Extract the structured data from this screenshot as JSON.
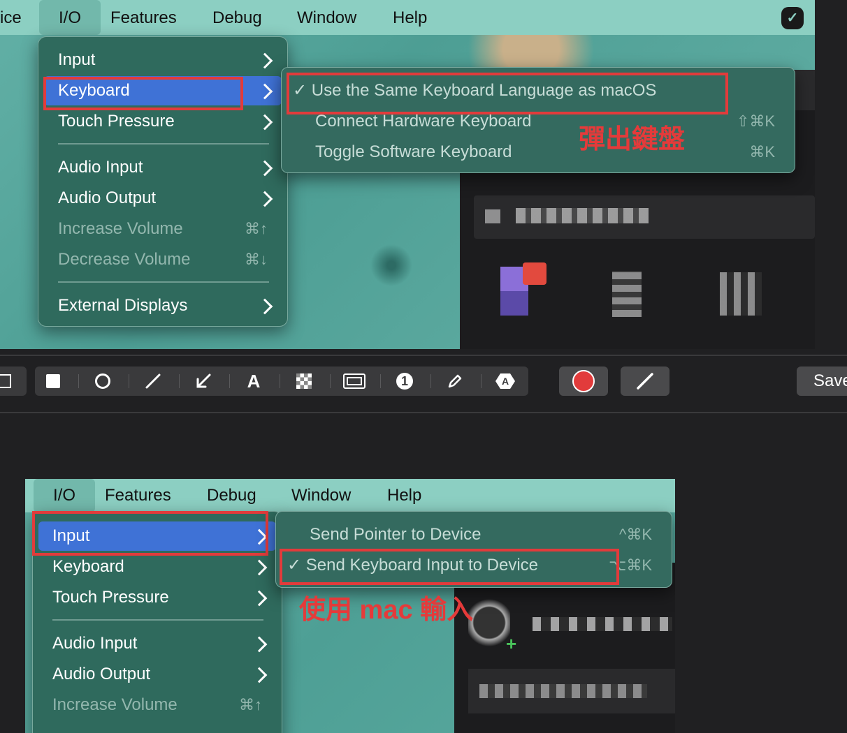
{
  "top": {
    "menubar": {
      "partial_label": "ice",
      "io": "I/O",
      "features": "Features",
      "debug": "Debug",
      "window": "Window",
      "help": "Help"
    },
    "io_menu": {
      "items": [
        {
          "label": "Input",
          "submenu": true
        },
        {
          "label": "Keyboard",
          "submenu": true,
          "highlighted": true
        },
        {
          "label": "Touch Pressure",
          "submenu": true
        },
        {
          "label": "Audio Input",
          "submenu": true
        },
        {
          "label": "Audio Output",
          "submenu": true
        },
        {
          "label": "Increase Volume",
          "shortcut": "⌘↑",
          "disabled": true
        },
        {
          "label": "Decrease Volume",
          "shortcut": "⌘↓",
          "disabled": true
        },
        {
          "label": "External Displays",
          "submenu": true
        }
      ]
    },
    "keyboard_submenu": {
      "items": [
        {
          "label": "✓ Use the Same Keyboard Language as macOS",
          "shortcut": ""
        },
        {
          "label": "Connect Hardware Keyboard",
          "shortcut": "⇧⌘K"
        },
        {
          "label": "Toggle Software Keyboard",
          "shortcut": "⌘K"
        }
      ]
    },
    "annotation": "彈出鍵盤"
  },
  "toolbar": {
    "tools": [
      {
        "icon": "filled-square-icon"
      },
      {
        "icon": "circle-icon"
      },
      {
        "icon": "line-icon"
      },
      {
        "icon": "arrow-icon"
      },
      {
        "icon": "text-icon",
        "glyph": "A"
      },
      {
        "icon": "pixelate-icon"
      },
      {
        "icon": "rectangle-frame-icon"
      },
      {
        "icon": "counter-icon",
        "glyph": "1"
      },
      {
        "icon": "pencil-icon"
      },
      {
        "icon": "translate-icon"
      }
    ],
    "color_swatch": "#e23b3b",
    "save_label": "Save"
  },
  "bottom": {
    "menubar": {
      "io": "I/O",
      "features": "Features",
      "debug": "Debug",
      "window": "Window",
      "help": "Help"
    },
    "io_menu": {
      "items": [
        {
          "label": "Input",
          "submenu": true,
          "highlighted": true
        },
        {
          "label": "Keyboard",
          "submenu": true
        },
        {
          "label": "Touch Pressure",
          "submenu": true
        },
        {
          "label": "Audio Input",
          "submenu": true
        },
        {
          "label": "Audio Output",
          "submenu": true
        },
        {
          "label": "Increase Volume",
          "shortcut": "⌘↑",
          "disabled": true
        }
      ]
    },
    "input_submenu": {
      "items": [
        {
          "label": "Send Pointer to Device",
          "shortcut": "^⌘K"
        },
        {
          "label": "✓ Send Keyboard Input to Device",
          "shortcut": "⌥⌘K"
        }
      ]
    },
    "annotation": "使用 mac 輸入"
  },
  "colors": {
    "menu_bg": "#2f6a5d",
    "highlight": "#3f72d6",
    "annotation_red": "#e23b3b",
    "menubar_bg": "#8ccfc2"
  }
}
